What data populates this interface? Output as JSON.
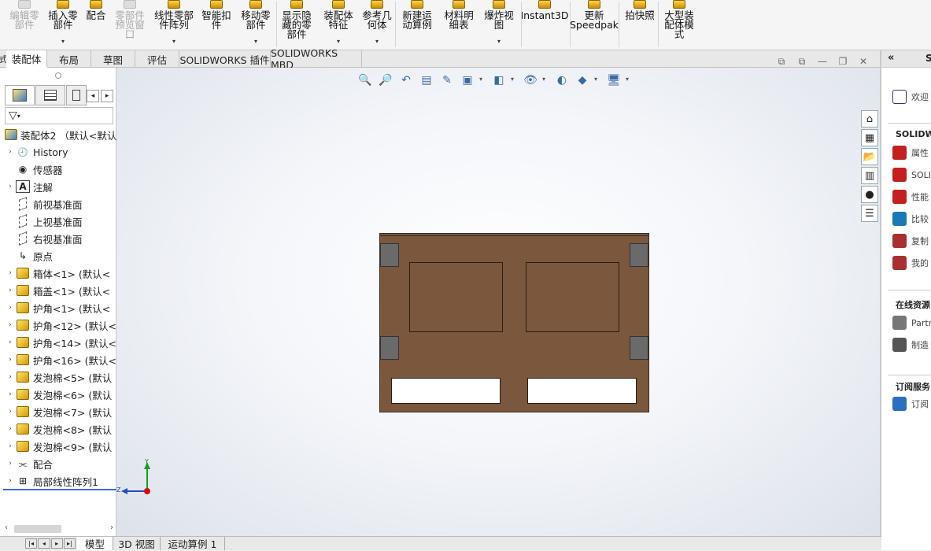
{
  "ribbon": {
    "buttons": [
      {
        "label": "编辑零\n部件",
        "disabled": true,
        "arrow": false
      },
      {
        "label": "插入零\n部件",
        "disabled": false,
        "arrow": true
      },
      {
        "label": "配合",
        "disabled": false,
        "arrow": false
      },
      {
        "label": "零部件\n预览窗\n口",
        "disabled": true,
        "arrow": false
      },
      {
        "label": "线性零部\n件阵列",
        "disabled": false,
        "arrow": true
      },
      {
        "label": "智能扣\n件",
        "disabled": false,
        "arrow": false
      },
      {
        "label": "移动零\n部件",
        "disabled": false,
        "arrow": true
      },
      {
        "label": "显示隐\n藏的零\n部件",
        "disabled": false,
        "arrow": false
      },
      {
        "label": "装配体\n特征",
        "disabled": false,
        "arrow": true
      },
      {
        "label": "参考几\n何体",
        "disabled": false,
        "arrow": true
      },
      {
        "label": "新建运\n动算例",
        "disabled": false,
        "arrow": false
      },
      {
        "label": "材料明\n细表",
        "disabled": false,
        "arrow": false
      },
      {
        "label": "爆炸视\n图",
        "disabled": false,
        "arrow": true
      },
      {
        "label": "Instant3D",
        "disabled": false,
        "arrow": false
      },
      {
        "label": "更新\nSpeedpak",
        "disabled": false,
        "arrow": false
      },
      {
        "label": "拍快照",
        "disabled": false,
        "arrow": false
      },
      {
        "label": "大型装\n配体模\n式",
        "disabled": false,
        "arrow": false
      }
    ]
  },
  "tabs": [
    {
      "label": "装配体",
      "active": true
    },
    {
      "label": "布局",
      "active": false
    },
    {
      "label": "草图",
      "active": false
    },
    {
      "label": "评估",
      "active": false
    },
    {
      "label": "SOLIDWORKS 插件",
      "active": false
    },
    {
      "label": "SOLIDWORKS MBD",
      "active": false
    }
  ],
  "left_edge_glyph": "式",
  "tree": {
    "root": "装配体2 （默认<默认_",
    "items": [
      {
        "label": "History",
        "expand": true,
        "icon": "history-icon"
      },
      {
        "label": "传感器",
        "expand": false,
        "icon": "sensor-icon"
      },
      {
        "label": "注解",
        "expand": true,
        "icon": "annotation-icon"
      },
      {
        "label": "前视基准面",
        "expand": false,
        "icon": "plane-icon"
      },
      {
        "label": "上视基准面",
        "expand": false,
        "icon": "plane-icon"
      },
      {
        "label": "右视基准面",
        "expand": false,
        "icon": "plane-icon"
      },
      {
        "label": "原点",
        "expand": false,
        "icon": "origin-icon"
      },
      {
        "label": "箱体<1> (默认<",
        "expand": true,
        "icon": "part-icon"
      },
      {
        "label": "箱盖<1> (默认<",
        "expand": true,
        "icon": "part-icon"
      },
      {
        "label": "护角<1> (默认<",
        "expand": true,
        "icon": "part-icon"
      },
      {
        "label": "护角<12> (默认<",
        "expand": true,
        "icon": "part-icon"
      },
      {
        "label": "护角<14> (默认<",
        "expand": true,
        "icon": "part-icon"
      },
      {
        "label": "护角<16> (默认<",
        "expand": true,
        "icon": "part-icon"
      },
      {
        "label": "发泡棉<5> (默认",
        "expand": true,
        "icon": "part-icon"
      },
      {
        "label": "发泡棉<6> (默认",
        "expand": true,
        "icon": "part-icon"
      },
      {
        "label": "发泡棉<7> (默认",
        "expand": true,
        "icon": "part-icon"
      },
      {
        "label": "发泡棉<8> (默认",
        "expand": true,
        "icon": "part-icon"
      },
      {
        "label": "发泡棉<9> (默认",
        "expand": true,
        "icon": "part-icon"
      },
      {
        "label": "配合",
        "expand": true,
        "icon": "mates-icon"
      },
      {
        "label": "局部线性阵列1",
        "expand": true,
        "icon": "pattern-icon"
      }
    ]
  },
  "triad": {
    "y": "Y",
    "z": "Z"
  },
  "bottom_tabs": [
    {
      "label": "模型",
      "active": true
    },
    {
      "label": "3D 视图",
      "active": false
    },
    {
      "label": "运动算例 1",
      "active": false
    }
  ],
  "right_pane": {
    "title_fragment": "S",
    "welcome": "欢迎",
    "section1": "SOLIDWO",
    "rows1": [
      "属性",
      "SOLI",
      "性能",
      "比较",
      "复制",
      "我的"
    ],
    "section2": "在线资源",
    "rows2": [
      "Partr",
      "制造"
    ],
    "section3": "订阅服务",
    "rows3": [
      "订阅"
    ]
  },
  "colors": {
    "box_brown": "#7a573d",
    "corner_gray": "#6a6a6a",
    "accent_blue": "#1f5fbf"
  }
}
